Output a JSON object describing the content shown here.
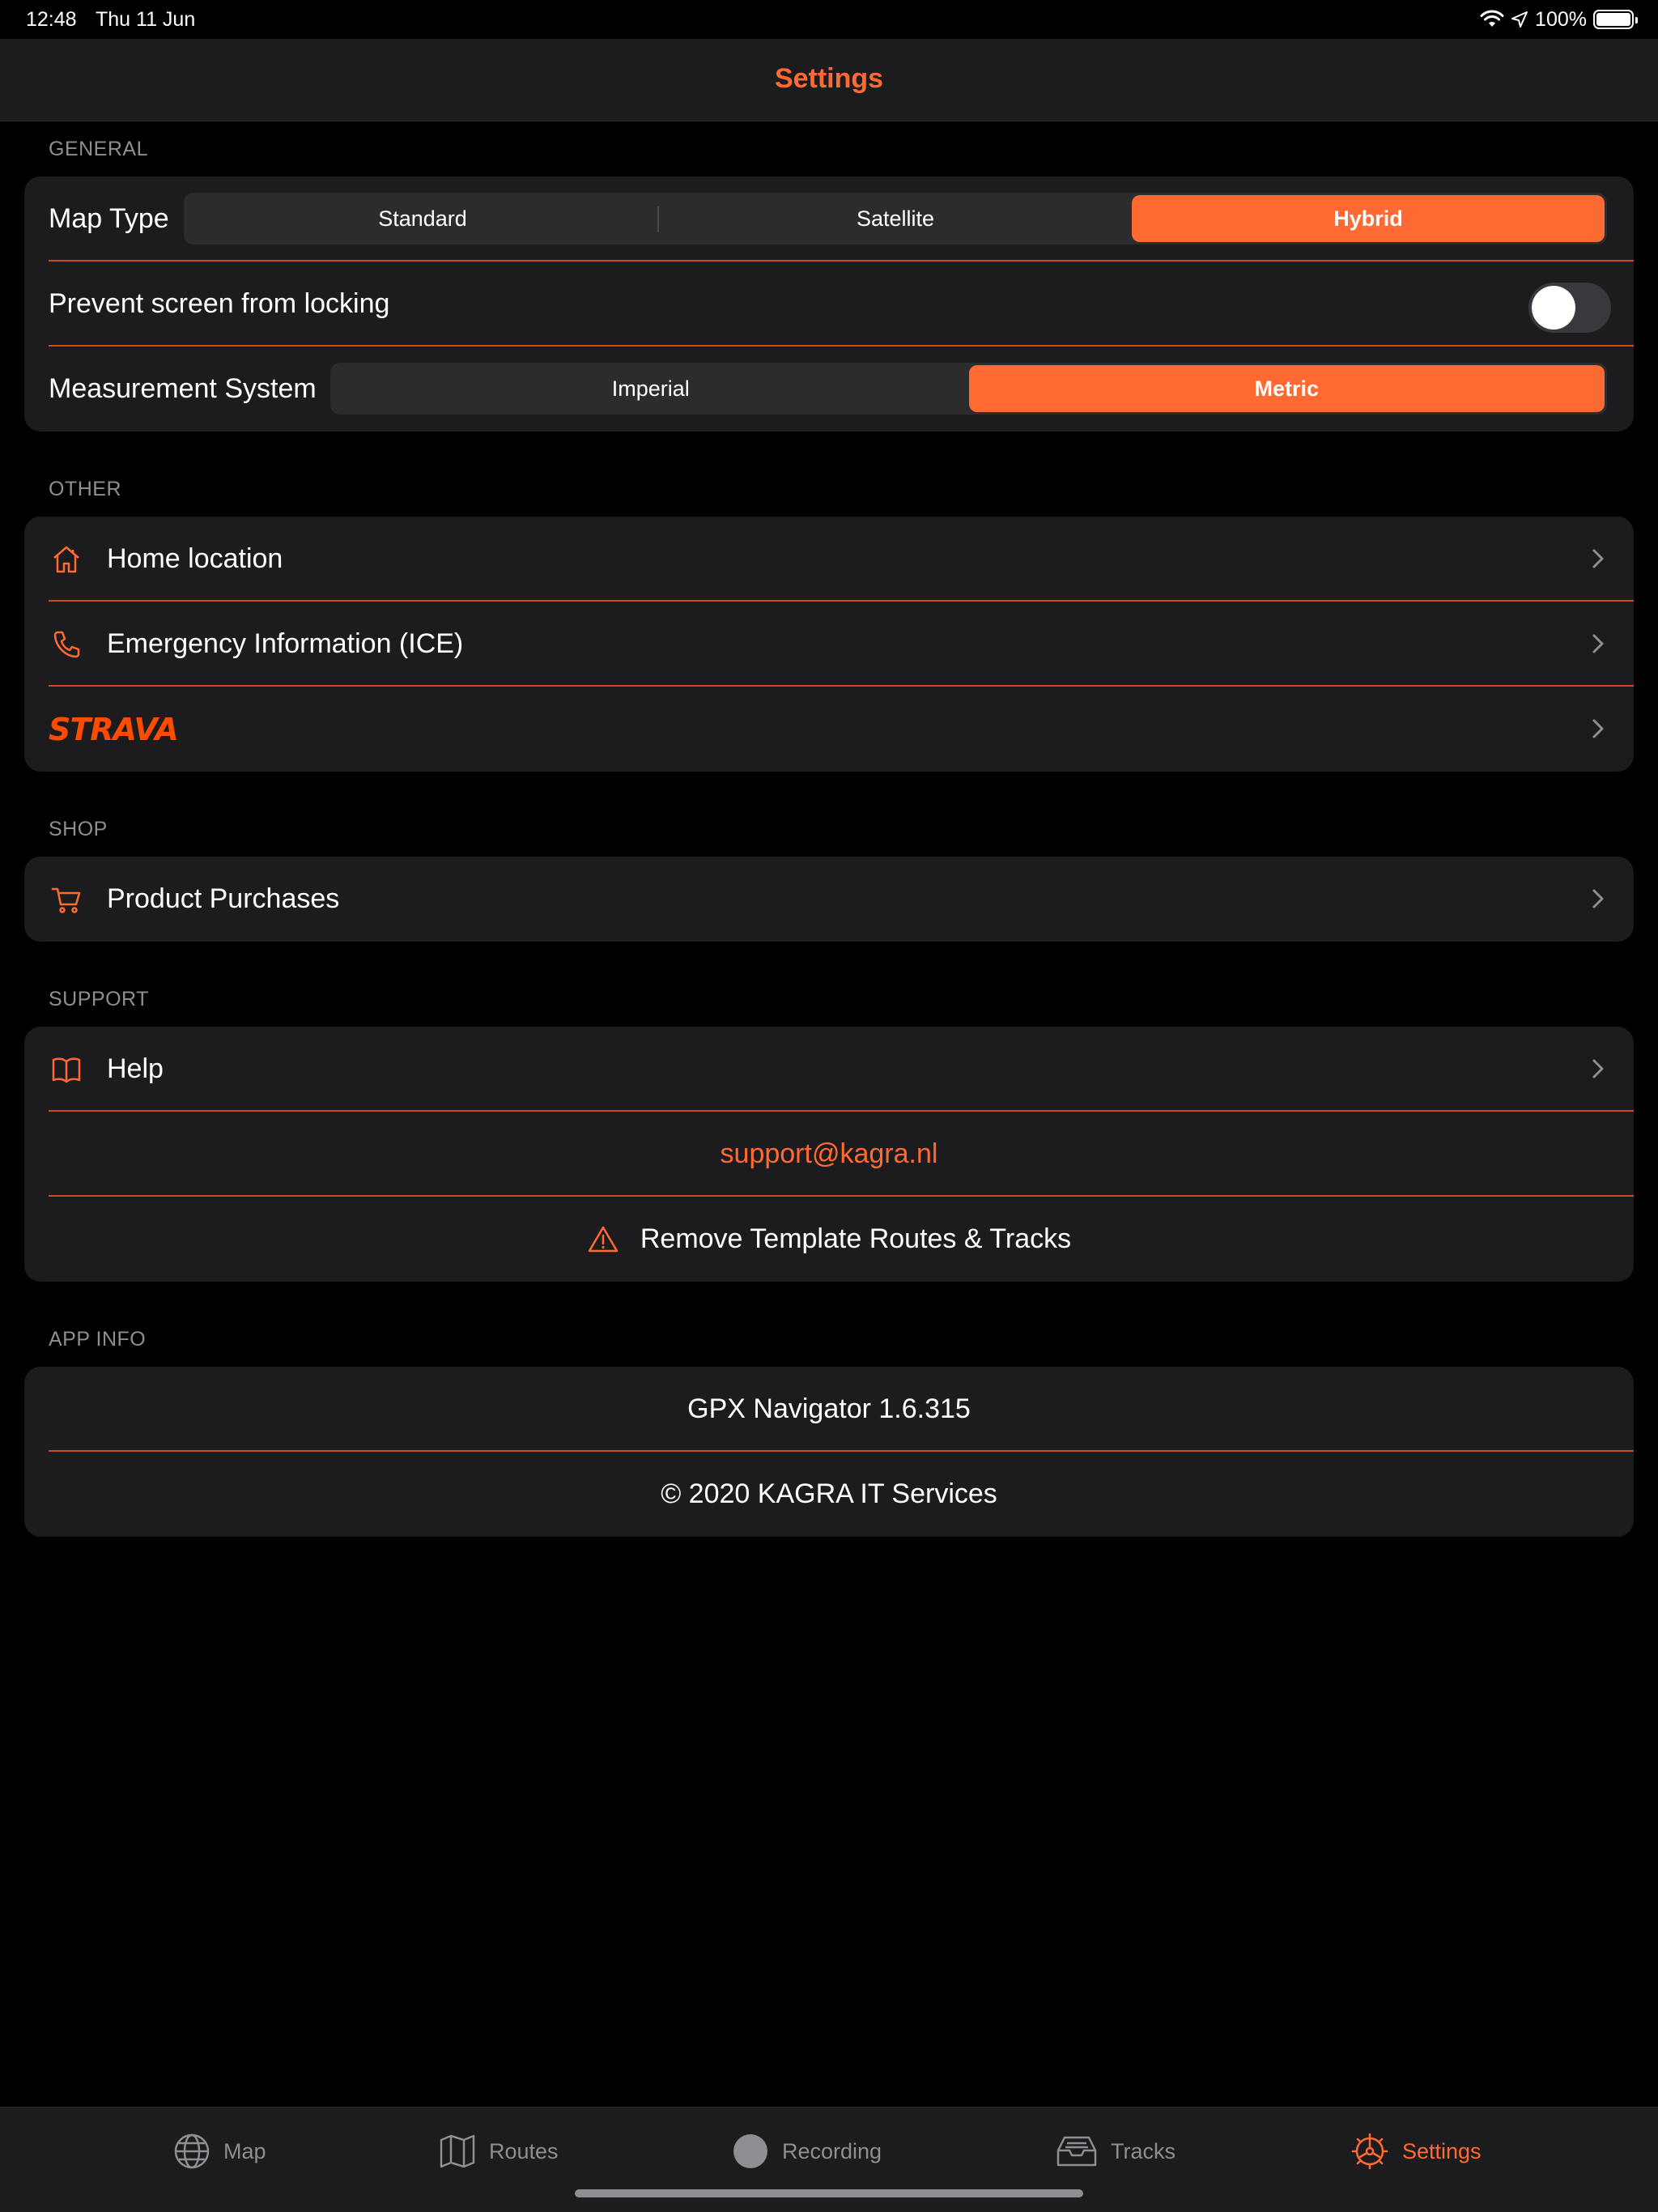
{
  "status": {
    "time": "12:48",
    "date": "Thu 11 Jun",
    "battery": "100%"
  },
  "nav": {
    "title": "Settings"
  },
  "sections": {
    "general": "GENERAL",
    "other": "OTHER",
    "shop": "SHOP",
    "support": "SUPPORT",
    "app_info": "APP INFO"
  },
  "general": {
    "map_type_label": "Map Type",
    "map_type_options": [
      "Standard",
      "Satellite",
      "Hybrid"
    ],
    "map_type_selected": "Hybrid",
    "prevent_lock_label": "Prevent screen from locking",
    "prevent_lock_on": false,
    "measurement_label": "Measurement System",
    "measurement_options": [
      "Imperial",
      "Metric"
    ],
    "measurement_selected": "Metric"
  },
  "other": {
    "home_location": "Home location",
    "emergency_info": "Emergency Information (ICE)",
    "strava": "STRAVA"
  },
  "shop": {
    "product_purchases": "Product Purchases"
  },
  "support": {
    "help": "Help",
    "email": "support@kagra.nl",
    "remove_templates": "Remove Template Routes & Tracks"
  },
  "app_info": {
    "version": "GPX Navigator 1.6.315",
    "copyright": "© 2020 KAGRA IT Services"
  },
  "tabs": [
    {
      "label": "Map",
      "icon": "globe-icon"
    },
    {
      "label": "Routes",
      "icon": "map-icon"
    },
    {
      "label": "Recording",
      "icon": "record-icon"
    },
    {
      "label": "Tracks",
      "icon": "tray-icon"
    },
    {
      "label": "Settings",
      "icon": "gear-icon"
    }
  ],
  "active_tab": "Settings",
  "colors": {
    "accent": "#ff6a33",
    "separator": "#c94c22",
    "background": "#000000",
    "cell": "#1c1c1e"
  }
}
